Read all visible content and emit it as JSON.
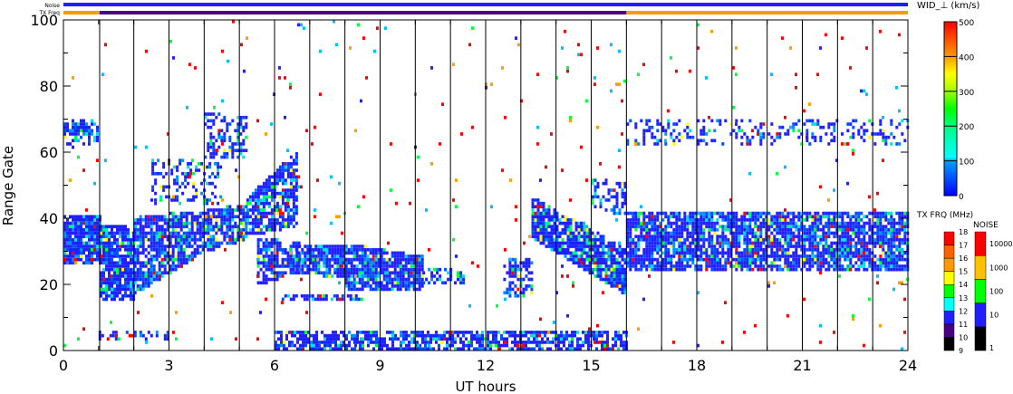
{
  "chart_data": {
    "type": "heatmap",
    "xlabel": "UT hours",
    "ylabel": "Range Gate",
    "xlim": [
      0,
      24
    ],
    "ylim": [
      0,
      100
    ],
    "xticks": [
      "0",
      "3",
      "6",
      "9",
      "12",
      "15",
      "18",
      "21",
      "24"
    ],
    "yticks": [
      "0",
      "20",
      "40",
      "60",
      "80",
      "100"
    ],
    "top_bars": {
      "noise_label": "Noise",
      "txfreq_label": "TX Freq",
      "txfreq_segments": [
        {
          "t0": 0,
          "t1": 1.03,
          "color": "#ff9900"
        },
        {
          "t0": 1.03,
          "t1": 16,
          "color": "#4b0082"
        },
        {
          "t0": 16,
          "t1": 24,
          "color": "#ff9900"
        }
      ],
      "noise_color": "#2020ff"
    },
    "scan_lines_hours": [
      1.03,
      2,
      3,
      4,
      5,
      6,
      7,
      8,
      9,
      10,
      11,
      12,
      13,
      14,
      15,
      16,
      17,
      18,
      19,
      20,
      21,
      22,
      23
    ],
    "echo_regions": [
      {
        "t0": 0,
        "t1": 1.03,
        "g0a": 26,
        "g1a": 41,
        "g0b": 26,
        "g1b": 41,
        "density": 0.9
      },
      {
        "t0": 0,
        "t1": 1,
        "g0a": 62,
        "g1a": 70,
        "g0b": 62,
        "g1b": 70,
        "density": 0.5
      },
      {
        "t0": 1.03,
        "t1": 2,
        "g0a": 16,
        "g1a": 38,
        "g0b": 15,
        "g1b": 38,
        "density": 0.85
      },
      {
        "t0": 2,
        "t1": 4,
        "g0a": 17,
        "g1a": 40,
        "g0b": 30,
        "g1b": 42,
        "density": 0.8
      },
      {
        "t0": 2.5,
        "t1": 4.5,
        "g0a": 44,
        "g1a": 58,
        "g0b": 45,
        "g1b": 56,
        "density": 0.35
      },
      {
        "t0": 4,
        "t1": 5.2,
        "g0a": 30,
        "g1a": 42,
        "g0b": 34,
        "g1b": 44,
        "density": 0.85
      },
      {
        "t0": 4,
        "t1": 5.2,
        "g0a": 58,
        "g1a": 72,
        "g0b": 58,
        "g1b": 70,
        "density": 0.45
      },
      {
        "t0": 5.2,
        "t1": 6.6,
        "g0a": 35,
        "g1a": 46,
        "g0b": 38,
        "g1b": 60,
        "density": 0.8
      },
      {
        "t0": 5.5,
        "t1": 6.7,
        "g0a": 20,
        "g1a": 34,
        "g0b": 24,
        "g1b": 32,
        "density": 0.7
      },
      {
        "t0": 6.6,
        "t1": 8,
        "g0a": 24,
        "g1a": 32,
        "g0b": 22,
        "g1b": 32,
        "density": 0.85
      },
      {
        "t0": 6.2,
        "t1": 8.5,
        "g0a": 15,
        "g1a": 17,
        "g0b": 15,
        "g1b": 17,
        "density": 0.6
      },
      {
        "t0": 8,
        "t1": 10.2,
        "g0a": 19,
        "g1a": 32,
        "g0b": 18,
        "g1b": 28,
        "density": 0.9
      },
      {
        "t0": 10.2,
        "t1": 11,
        "g0a": 20,
        "g1a": 25,
        "g0b": 20,
        "g1b": 24,
        "density": 0.5
      },
      {
        "t0": 11.1,
        "t1": 11.4,
        "g0a": 20,
        "g1a": 25,
        "g0b": 20,
        "g1b": 25,
        "density": 0.6
      },
      {
        "t0": 12.5,
        "t1": 13.3,
        "g0a": 16,
        "g1a": 28,
        "g0b": 16,
        "g1b": 28,
        "density": 0.5
      },
      {
        "t0": 13.3,
        "t1": 16,
        "g0a": 34,
        "g1a": 46,
        "g0b": 17,
        "g1b": 30,
        "density": 0.85
      },
      {
        "t0": 15,
        "t1": 16,
        "g0a": 44,
        "g1a": 52,
        "g0b": 40,
        "g1b": 50,
        "density": 0.4
      },
      {
        "t0": 16,
        "t1": 24,
        "g0a": 25,
        "g1a": 42,
        "g0b": 24,
        "g1b": 42,
        "density": 0.8
      },
      {
        "t0": 16,
        "t1": 24,
        "g0a": 62,
        "g1a": 70,
        "g0b": 62,
        "g1b": 70,
        "density": 0.25
      },
      {
        "t0": 6,
        "t1": 16,
        "g0a": 0,
        "g1a": 6,
        "g0b": 0,
        "g1b": 6,
        "density": 0.7
      },
      {
        "t0": 1,
        "t1": 3,
        "g0a": 3,
        "g1a": 6,
        "g0b": 3,
        "g1b": 6,
        "density": 0.4
      }
    ],
    "background_scatter_density": 0.012
  },
  "colorbars": {
    "width": {
      "title": "WID_⊥ (km/s)",
      "labels": [
        "0",
        "100",
        "200",
        "300",
        "400",
        "500"
      ]
    },
    "txfreq": {
      "title": "TX FRQ (MHz)",
      "labels": [
        "9",
        "10",
        "11",
        "12",
        "13",
        "14",
        "15",
        "16",
        "17",
        "18"
      ],
      "colors": [
        "#000000",
        "#4b0082",
        "#2020ff",
        "#00ffff",
        "#00ff00",
        "#ffff00",
        "#ff9900",
        "#ff6000",
        "#ff0000"
      ]
    },
    "noise": {
      "title": "NOISE",
      "labels": [
        "1",
        "10",
        "100",
        "1000",
        "10000"
      ],
      "colors": [
        "#000000",
        "#2020ff",
        "#00ff00",
        "#ffc000",
        "#ff0000"
      ]
    }
  }
}
